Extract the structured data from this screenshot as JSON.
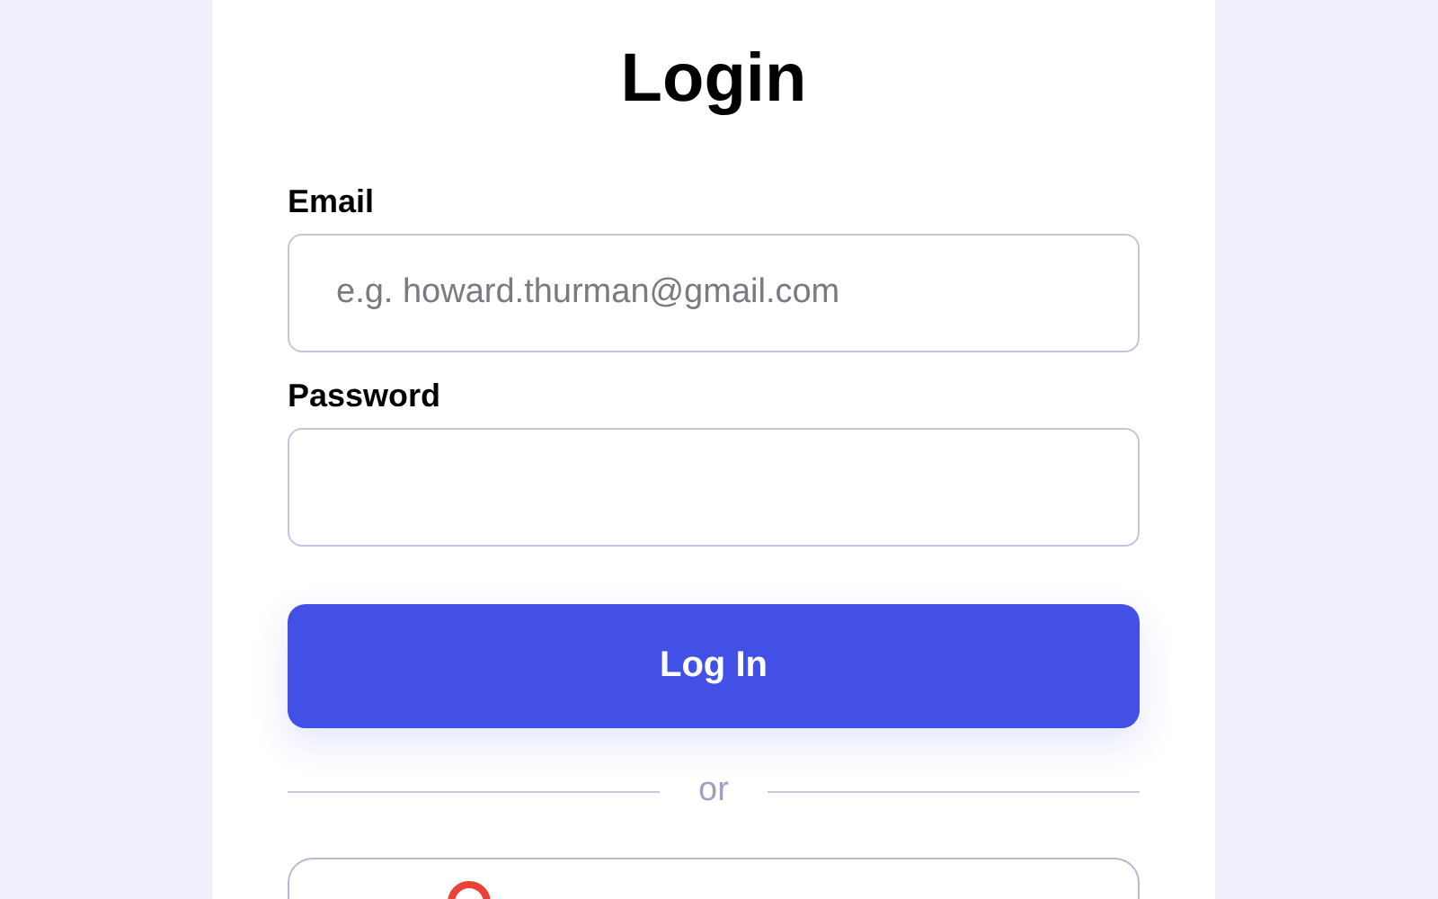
{
  "title": "Login",
  "fields": [
    {
      "label": "Email",
      "placeholder": "e.g. howard.thurman@gmail.com"
    },
    {
      "label": "Password"
    }
  ],
  "submit": "Log In",
  "divider": "or"
}
